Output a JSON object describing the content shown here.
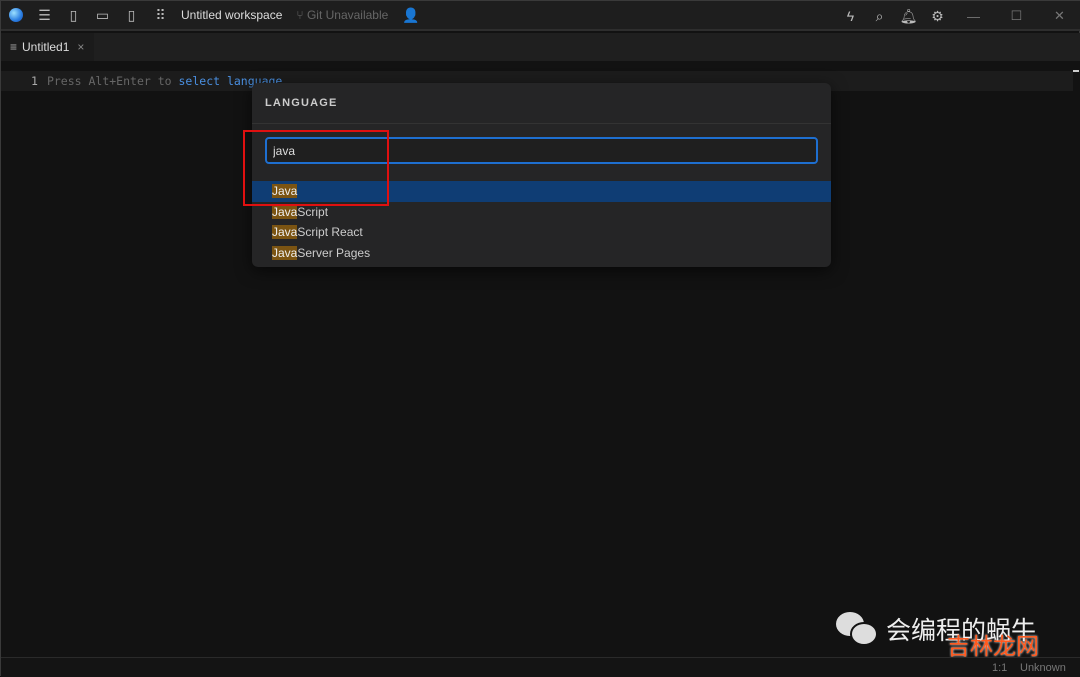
{
  "titlebar": {
    "workspace": "Untitled workspace",
    "git": "Git Unavailable",
    "git_icon": "branch-icon"
  },
  "tab": {
    "label": "Untitled1",
    "close": "×"
  },
  "editor": {
    "line_number": "1",
    "hint_prefix": "Press Alt+Enter to ",
    "hint_keyword": "select language"
  },
  "language_picker": {
    "title": "LANGUAGE",
    "query": "java",
    "items": [
      {
        "match": "Java",
        "rest": "",
        "selected": true
      },
      {
        "match": "Java",
        "rest": "Script",
        "selected": false
      },
      {
        "match": "Java",
        "rest": "Script React",
        "selected": false
      },
      {
        "match": "Java",
        "rest": "Server Pages",
        "selected": false
      }
    ]
  },
  "status": {
    "position": "1:1",
    "language": "Unknown"
  },
  "watermark": {
    "text": "会编程的蜗牛",
    "overlay": "吉林龙网"
  },
  "colors": {
    "accent": "#1e6fd0",
    "selection": "#0f3d74",
    "match_highlight": "#7b5412",
    "annotation": "#e01010"
  }
}
